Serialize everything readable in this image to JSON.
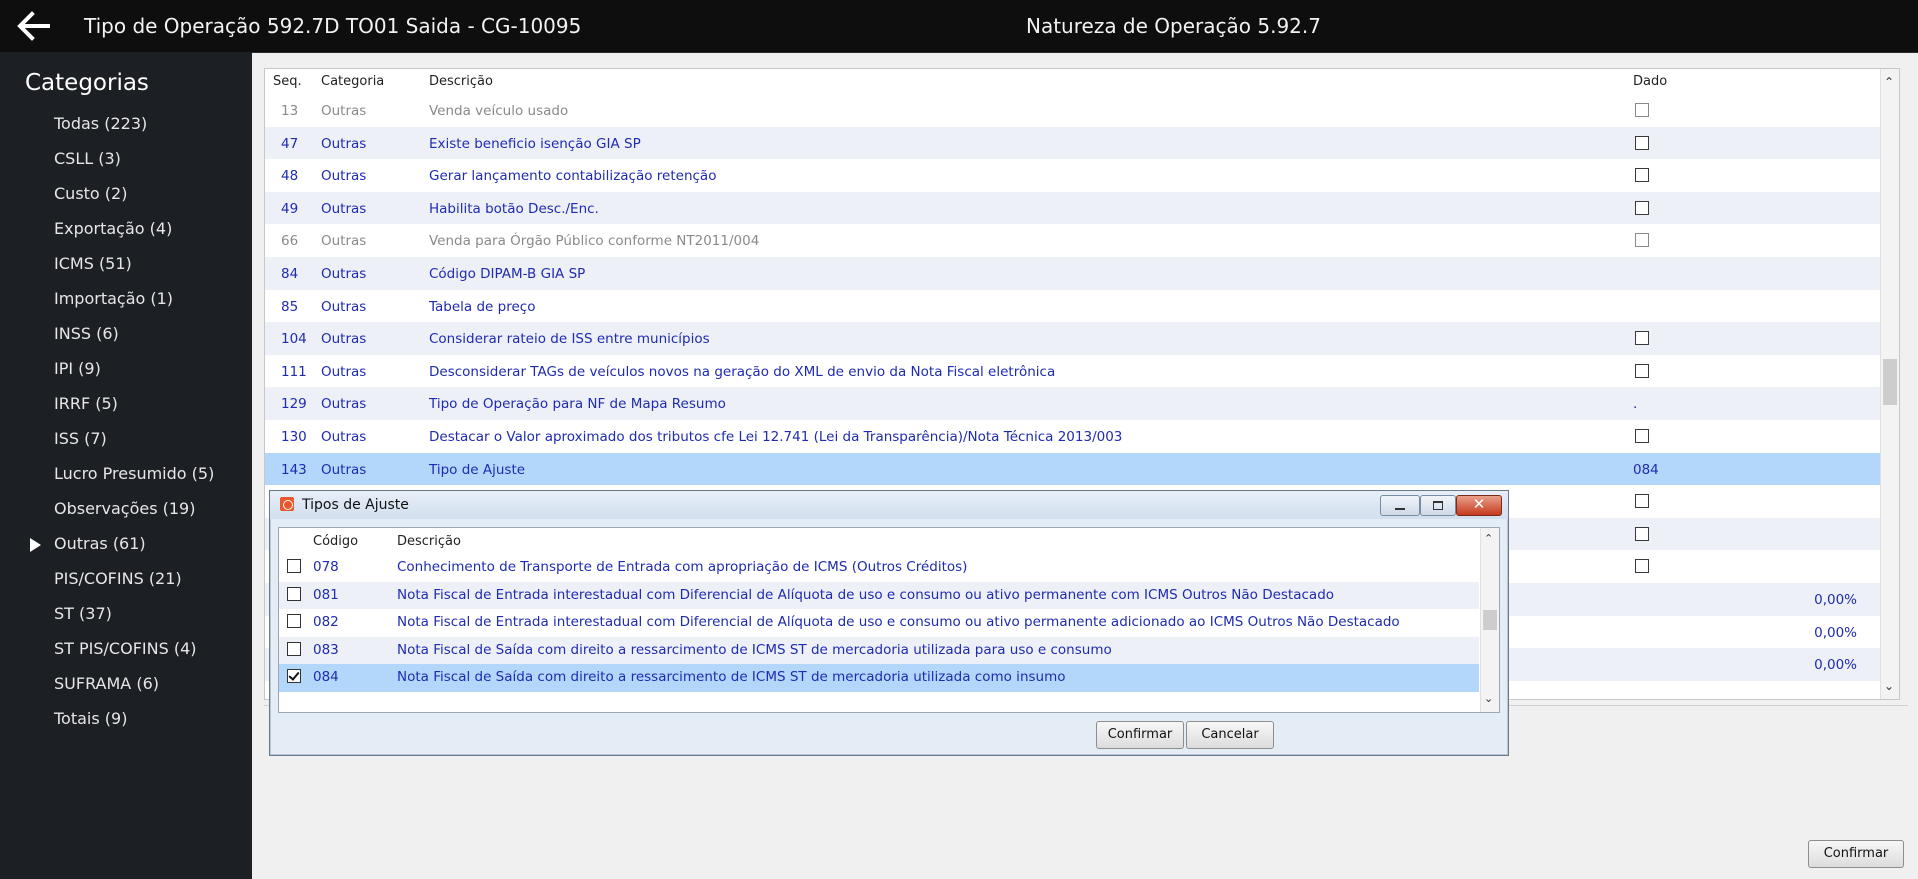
{
  "header": {
    "title": "Tipo de Operação 592.7D TO01 Saida - CG-10095",
    "center_title": "Natureza de Operação 5.92.7"
  },
  "sidebar": {
    "title": "Categorias",
    "items": [
      {
        "label": "Todas (223)",
        "selected": false
      },
      {
        "label": "CSLL (3)",
        "selected": false
      },
      {
        "label": "Custo (2)",
        "selected": false
      },
      {
        "label": "Exportação (4)",
        "selected": false
      },
      {
        "label": "ICMS (51)",
        "selected": false
      },
      {
        "label": "Importação (1)",
        "selected": false
      },
      {
        "label": "INSS (6)",
        "selected": false
      },
      {
        "label": "IPI (9)",
        "selected": false
      },
      {
        "label": "IRRF (5)",
        "selected": false
      },
      {
        "label": "ISS (7)",
        "selected": false
      },
      {
        "label": "Lucro Presumido (5)",
        "selected": false
      },
      {
        "label": "Observações (19)",
        "selected": false
      },
      {
        "label": "Outras (61)",
        "selected": true
      },
      {
        "label": "PIS/COFINS (21)",
        "selected": false
      },
      {
        "label": "ST (37)",
        "selected": false
      },
      {
        "label": "ST PIS/COFINS (4)",
        "selected": false
      },
      {
        "label": "SUFRAMA (6)",
        "selected": false
      },
      {
        "label": "Totais (9)",
        "selected": false
      }
    ]
  },
  "grid": {
    "columns": {
      "seq": "Seq.",
      "categoria": "Categoria",
      "descricao": "Descrição",
      "dado": "Dado"
    },
    "rows": [
      {
        "seq": "13",
        "categoria": "Outras",
        "descricao": "Venda veículo usado",
        "dado_type": "checkbox",
        "dado": "",
        "active": false,
        "selected": false
      },
      {
        "seq": "47",
        "categoria": "Outras",
        "descricao": "Existe beneficio isenção GIA SP",
        "dado_type": "checkbox",
        "dado": "",
        "active": true,
        "selected": false
      },
      {
        "seq": "48",
        "categoria": "Outras",
        "descricao": "Gerar lançamento contabilização retenção",
        "dado_type": "checkbox",
        "dado": "",
        "active": true,
        "selected": false
      },
      {
        "seq": "49",
        "categoria": "Outras",
        "descricao": "Habilita botão Desc./Enc.",
        "dado_type": "checkbox",
        "dado": "",
        "active": true,
        "selected": false
      },
      {
        "seq": "66",
        "categoria": "Outras",
        "descricao": "Venda para Órgão Público conforme NT2011/004",
        "dado_type": "checkbox",
        "dado": "",
        "active": false,
        "selected": false
      },
      {
        "seq": "84",
        "categoria": "Outras",
        "descricao": "Código DIPAM-B GIA SP",
        "dado_type": "text",
        "dado": "",
        "active": true,
        "selected": false
      },
      {
        "seq": "85",
        "categoria": "Outras",
        "descricao": "Tabela de preço",
        "dado_type": "text",
        "dado": "",
        "active": true,
        "selected": false
      },
      {
        "seq": "104",
        "categoria": "Outras",
        "descricao": "Considerar rateio de ISS entre municípios",
        "dado_type": "checkbox",
        "dado": "",
        "active": true,
        "selected": false
      },
      {
        "seq": "111",
        "categoria": "Outras",
        "descricao": "Desconsiderar TAGs de veículos novos na geração do XML de envio da Nota Fiscal eletrônica",
        "dado_type": "checkbox",
        "dado": "",
        "active": true,
        "selected": false
      },
      {
        "seq": "129",
        "categoria": "Outras",
        "descricao": "Tipo de Operação para NF de Mapa Resumo",
        "dado_type": "text",
        "dado": ".",
        "active": true,
        "selected": false
      },
      {
        "seq": "130",
        "categoria": "Outras",
        "descricao": "Destacar o Valor aproximado dos tributos cfe Lei 12.741 (Lei da Transparência)/Nota Técnica 2013/003",
        "dado_type": "checkbox",
        "dado": "",
        "active": true,
        "selected": false
      },
      {
        "seq": "143",
        "categoria": "Outras",
        "descricao": "Tipo de Ajuste",
        "dado_type": "text",
        "dado": "084",
        "active": true,
        "selected": true
      },
      {
        "seq": "",
        "categoria": "",
        "descricao": "",
        "dado_type": "checkbox",
        "dado": "",
        "active": true,
        "selected": false
      },
      {
        "seq": "",
        "categoria": "",
        "descricao": "",
        "dado_type": "checkbox",
        "dado": "",
        "active": true,
        "selected": false
      },
      {
        "seq": "",
        "categoria": "",
        "descricao": "",
        "dado_type": "checkbox",
        "dado": "",
        "active": true,
        "selected": false
      },
      {
        "seq": "",
        "categoria": "",
        "descricao": "",
        "dado_type": "right",
        "dado": "0,00%",
        "active": true,
        "selected": false
      },
      {
        "seq": "",
        "categoria": "",
        "descricao": "",
        "dado_type": "right",
        "dado": "0,00%",
        "active": true,
        "selected": false
      },
      {
        "seq": "",
        "categoria": "",
        "descricao": "",
        "dado_type": "right",
        "dado": "0,00%",
        "active": true,
        "selected": false
      }
    ]
  },
  "dialog": {
    "title": "Tipos de Ajuste",
    "columns": {
      "codigo": "Código",
      "descricao": "Descrição"
    },
    "rows": [
      {
        "codigo": "078",
        "descricao": "Conhecimento de Transporte de Entrada com apropriação de ICMS (Outros Créditos)",
        "checked": false,
        "selected": false
      },
      {
        "codigo": "081",
        "descricao": "Nota Fiscal de Entrada interestadual com Diferencial de Alíquota de uso e consumo ou ativo permanente com ICMS Outros Não Destacado",
        "checked": false,
        "selected": false
      },
      {
        "codigo": "082",
        "descricao": "Nota Fiscal de Entrada interestadual com Diferencial de Alíquota de uso e consumo ou ativo permanente adicionado ao ICMS Outros Não Destacado",
        "checked": false,
        "selected": false
      },
      {
        "codigo": "083",
        "descricao": "Nota Fiscal de Saída com direito a ressarcimento de ICMS ST de mercadoria utilizada para uso e consumo",
        "checked": false,
        "selected": false
      },
      {
        "codigo": "084",
        "descricao": "Nota Fiscal de Saída com direito a ressarcimento de ICMS ST de mercadoria utilizada como insumo",
        "checked": true,
        "selected": true
      }
    ],
    "confirm_label": "Confirmar",
    "cancel_label": "Cancelar"
  },
  "footer": {
    "confirm_label": "Confirmar"
  },
  "icons": {
    "back": "arrow-left-icon",
    "selected_category": "triangle-right-icon",
    "dialog_app": "app-icon",
    "minimize": "minimize-icon",
    "maximize": "maximize-icon",
    "close": "close-icon",
    "scroll_up": "chevron-up-icon",
    "scroll_down": "chevron-down-icon"
  },
  "colors": {
    "header_bg": "#0e0e0e",
    "sidebar_bg": "#1c1f24",
    "link_blue": "#1f2bb0",
    "selected_row": "#b3d7fb",
    "inactive_text": "#8a8a8a"
  }
}
